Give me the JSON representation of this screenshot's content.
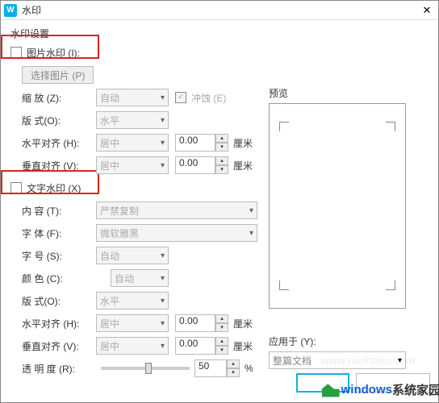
{
  "window": {
    "title": "水印"
  },
  "group": {
    "settings": "水印设置"
  },
  "img_wm": {
    "checkbox_label": "图片水印 (I):",
    "select_pic": "选择图片 (P)",
    "zoom_label": "缩   放 (Z):",
    "zoom_value": "自动",
    "erosion": "冲蚀 (E)",
    "style_label": "版   式(O):",
    "style_value": "水平",
    "halign_label": "水平对齐 (H):",
    "halign_value": "居中",
    "halign_num": "0.00",
    "valign_label": "垂直对齐 (V):",
    "valign_value": "居中",
    "valign_num": "0.00",
    "unit": "厘米"
  },
  "txt_wm": {
    "checkbox_label": "文字水印 (X)",
    "content_label": "内   容 (T):",
    "content_value": "严禁复制",
    "font_label": "字   体 (F):",
    "font_value": "微软雅黑",
    "size_label": "字   号 (S):",
    "size_value": "自动",
    "color_label": "颜   色 (C):",
    "color_value": "自动",
    "style_label": "版   式(O):",
    "style_value": "水平",
    "halign_label": "水平对齐 (H):",
    "halign_value": "居中",
    "halign_num": "0.00",
    "valign_label": "垂直对齐 (V):",
    "valign_value": "居中",
    "valign_num": "0.00",
    "opacity_label": "透 明 度 (R):",
    "opacity_value": "50",
    "opacity_unit": "%",
    "unit": "厘米"
  },
  "preview": {
    "label": "预览"
  },
  "apply": {
    "label": "应用于 (Y):",
    "value": "整篇文档"
  },
  "watermark": {
    "text1": "windows",
    "text2": "系统家园",
    "url": "www.ruishaitu.com"
  }
}
